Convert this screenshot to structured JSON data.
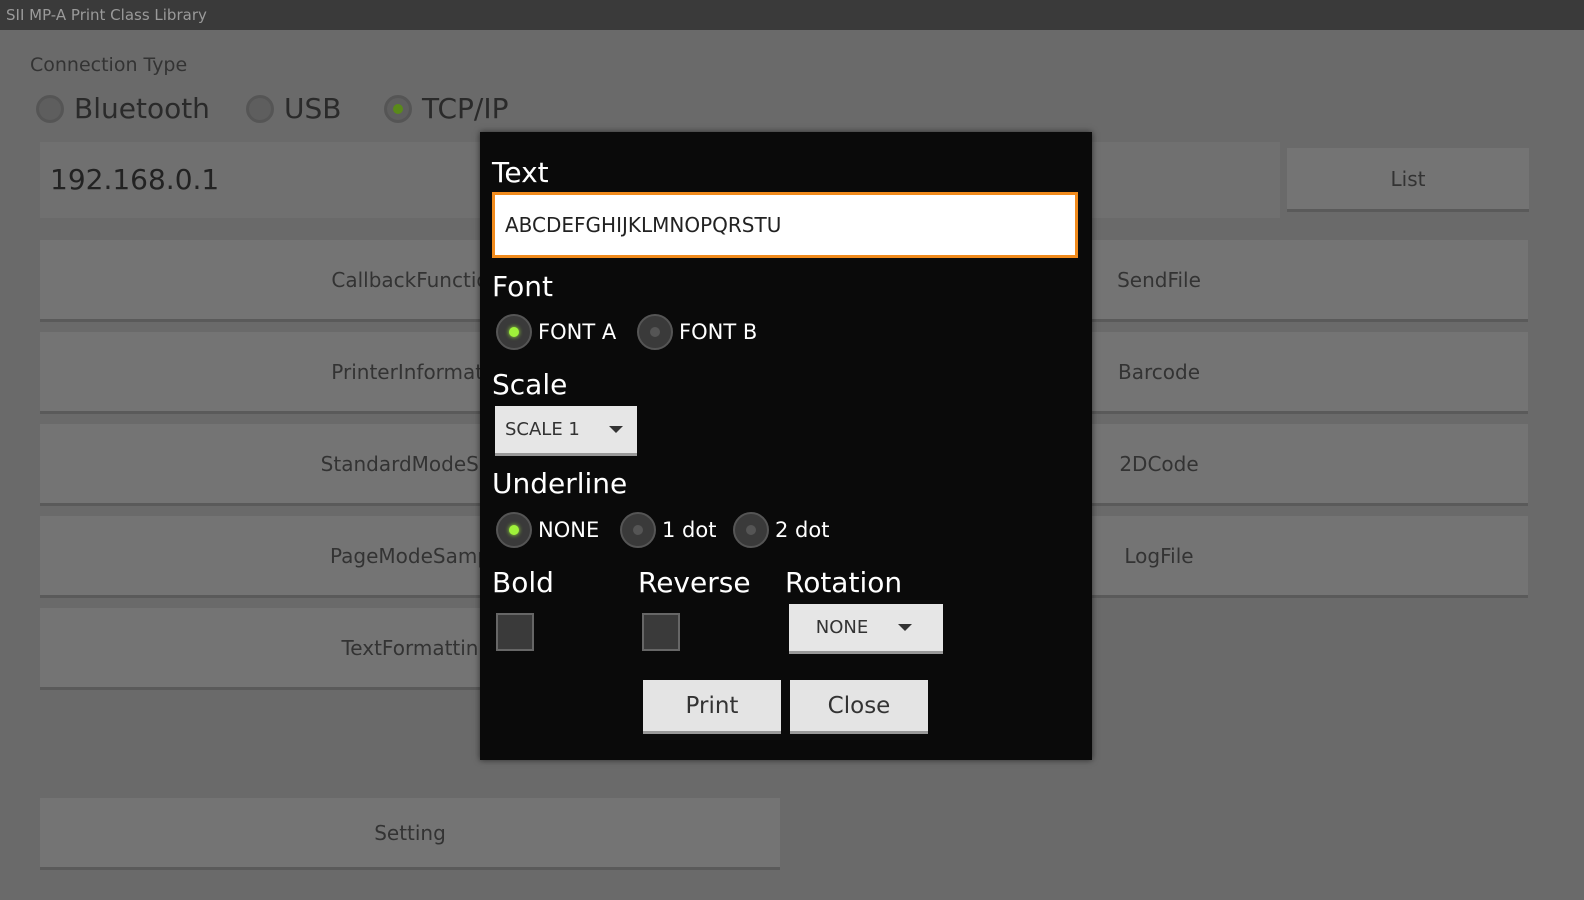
{
  "app": {
    "title": "SII MP-A Print Class Library"
  },
  "connection": {
    "label": "Connection Type",
    "options": [
      "Bluetooth",
      "USB",
      "TCP/IP"
    ],
    "selected": "TCP/IP",
    "address": "192.168.0.1",
    "list_button": "List"
  },
  "buttons": {
    "left": [
      "CallbackFunctio",
      "PrinterInformati",
      "StandardModeSar",
      "PageModeSamp",
      "TextFormattin"
    ],
    "right": [
      "SendFile",
      "Barcode",
      "2DCode",
      "LogFile"
    ],
    "setting": "Setting"
  },
  "dialog": {
    "text_label": "Text",
    "text_value": "ABCDEFGHIJKLMNOPQRSTU",
    "font_label": "Font",
    "font_options": [
      "FONT A",
      "FONT B"
    ],
    "font_selected": "FONT A",
    "scale_label": "Scale",
    "scale_value": "SCALE 1",
    "underline_label": "Underline",
    "underline_options": [
      "NONE",
      "1 dot",
      "2 dot"
    ],
    "underline_selected": "NONE",
    "bold_label": "Bold",
    "bold_checked": false,
    "reverse_label": "Reverse",
    "reverse_checked": false,
    "rotation_label": "Rotation",
    "rotation_value": "NONE",
    "print_button": "Print",
    "close_button": "Close"
  },
  "colors": {
    "accent": "#f08a1c",
    "radio_on": "#9ff23a",
    "dialog_bg": "#0a0a0a"
  }
}
